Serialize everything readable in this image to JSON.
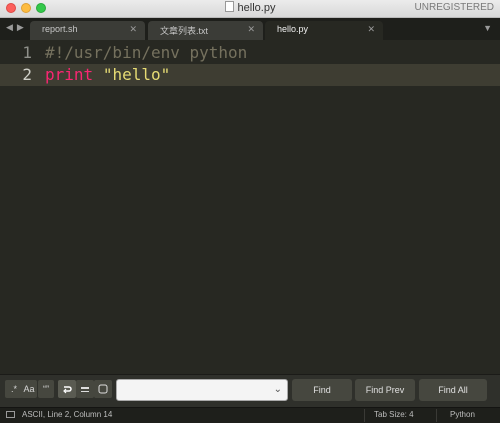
{
  "window": {
    "title": "hello.py",
    "license_status": "UNREGISTERED"
  },
  "tabs": [
    {
      "label": "report.sh",
      "active": false
    },
    {
      "label": "文章列表.txt",
      "active": false
    },
    {
      "label": "hello.py",
      "active": true
    }
  ],
  "editor": {
    "lines": [
      {
        "number": "1",
        "tokens": [
          {
            "text": "#!/usr/bin/env python",
            "kind": "comment"
          }
        ]
      },
      {
        "number": "2",
        "tokens": [
          {
            "text": "print",
            "kind": "keyword"
          },
          {
            "text": " ",
            "kind": "plain"
          },
          {
            "text": "\"hello\"",
            "kind": "string"
          }
        ],
        "current": true
      }
    ]
  },
  "find_panel": {
    "toggles": [
      {
        "name": "regex-toggle",
        "label": ".*"
      },
      {
        "name": "case-toggle",
        "label": "Aa"
      },
      {
        "name": "whole-word-toggle",
        "label": "“”"
      },
      {
        "name": "wrap-toggle",
        "label": "wrap"
      },
      {
        "name": "in-selection-toggle",
        "label": "sel"
      },
      {
        "name": "highlight-toggle",
        "label": "hl"
      }
    ],
    "search_value": "",
    "find_label": "Find",
    "find_prev_label": "Find Prev",
    "find_all_label": "Find All"
  },
  "status_bar": {
    "position": "ASCII, Line 2, Column 14",
    "tab_size": "Tab Size: 4",
    "syntax": "Python"
  },
  "colors": {
    "background": "#272822",
    "comment": "#75715e",
    "keyword": "#f92672",
    "string": "#e6db74"
  }
}
